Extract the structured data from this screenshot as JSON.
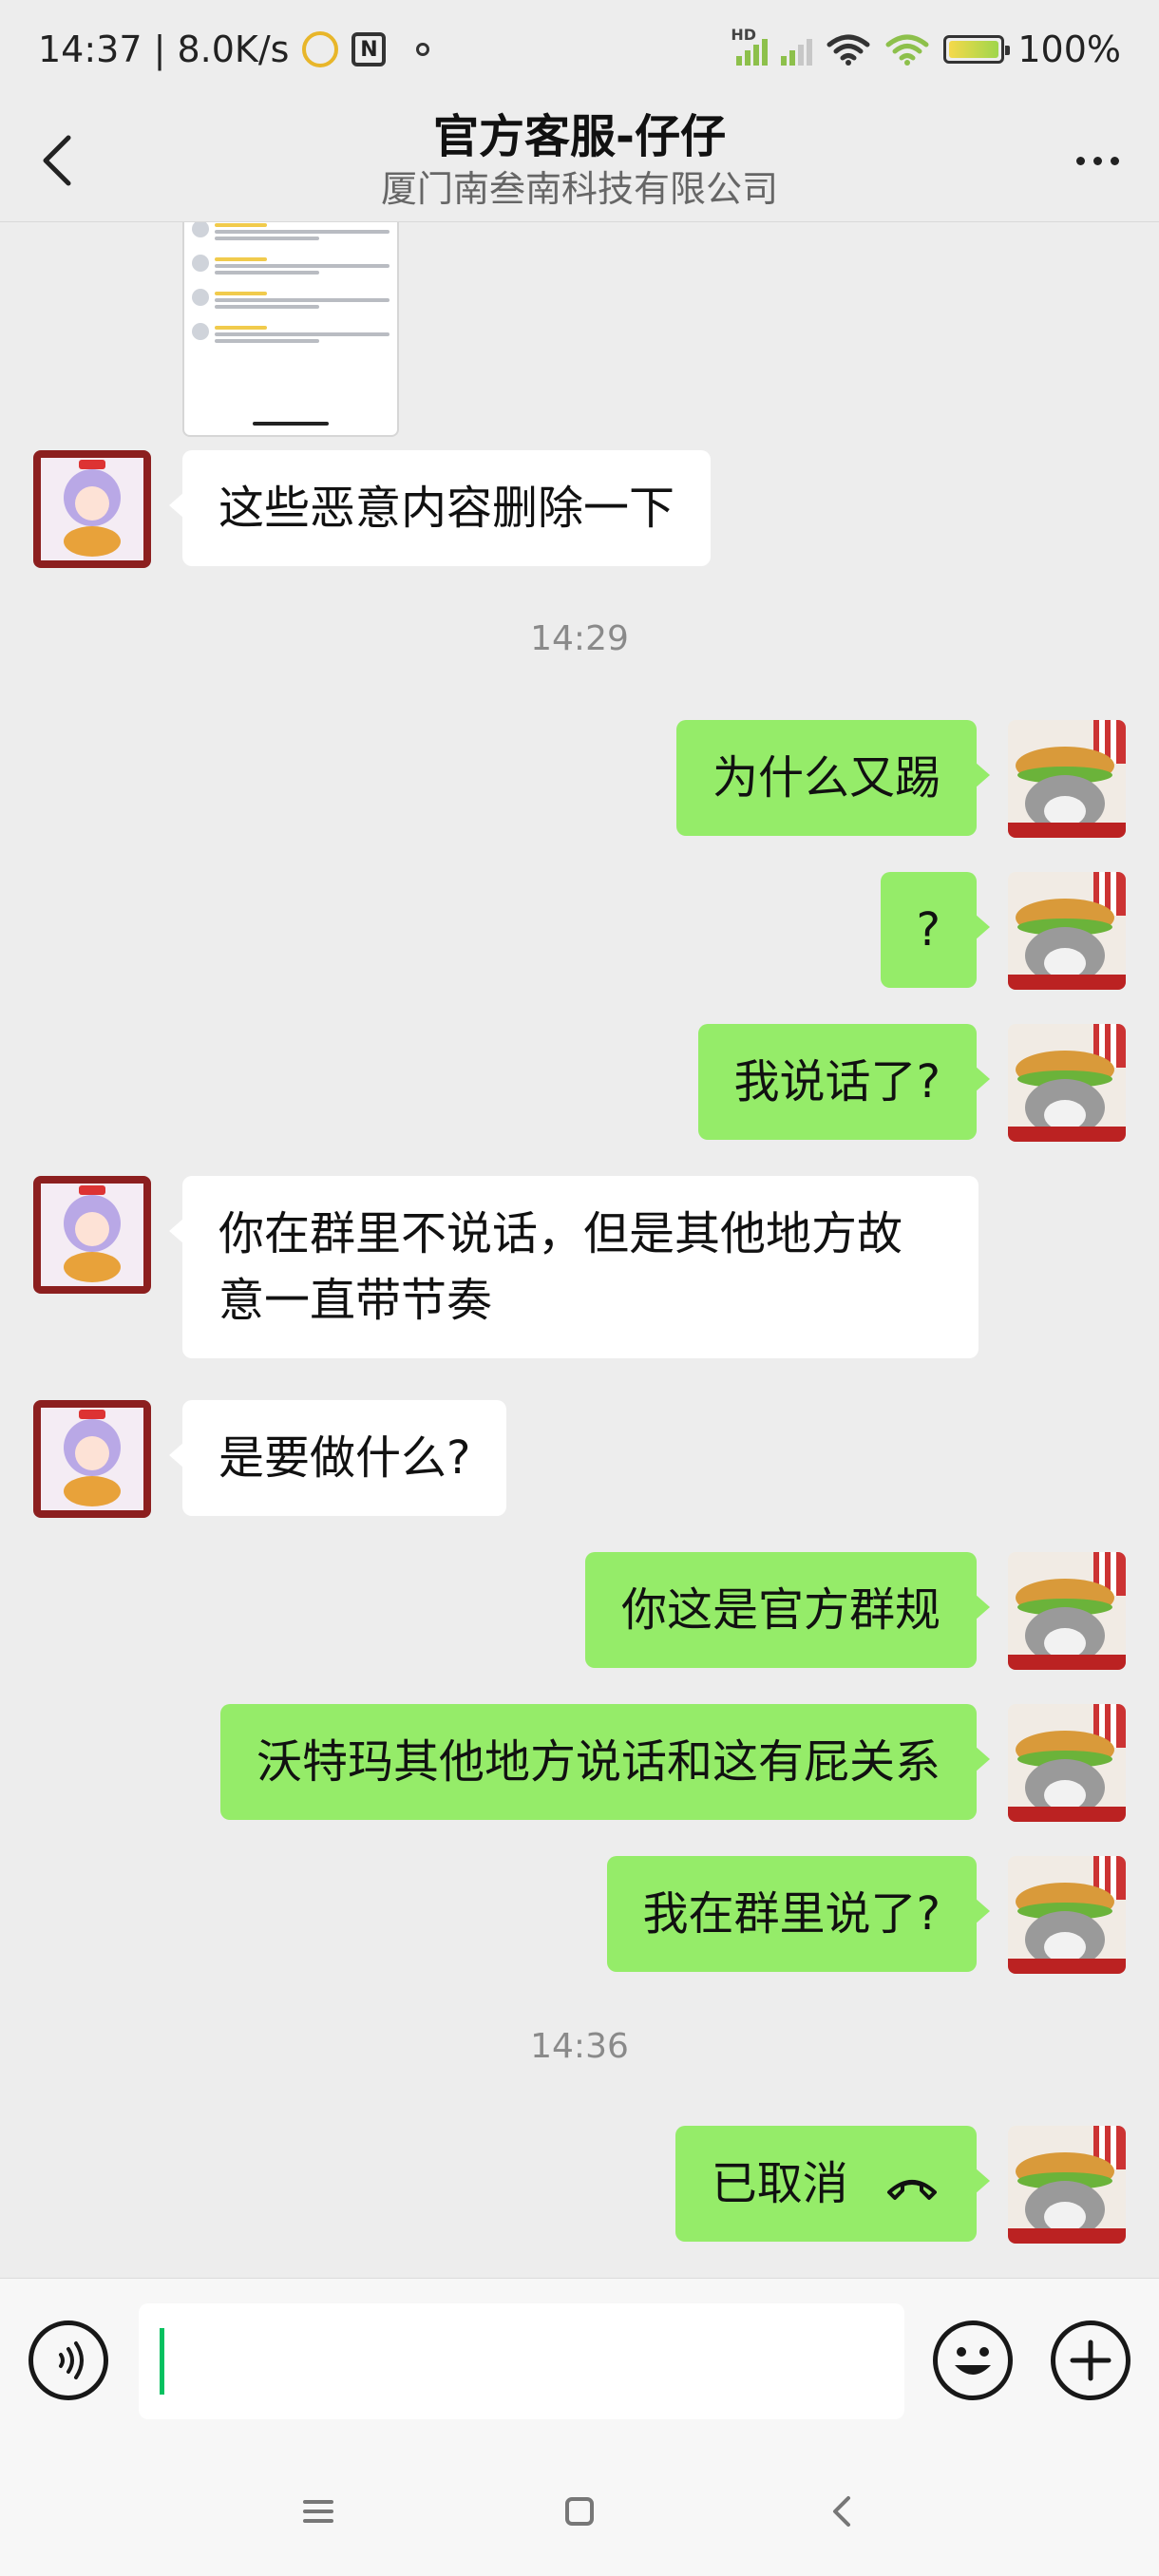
{
  "status_bar": {
    "time_speed": "14:37 | 8.0K/s",
    "hd_label": "HD",
    "battery_text": "100%",
    "battery_level": 1.0
  },
  "header": {
    "title": "官方客服-仔仔",
    "subtitle": "厦门南叁南科技有限公司",
    "back_icon": "chevron-left-icon",
    "more_icon": "more-dots-icon"
  },
  "messages": [
    {
      "side": "in",
      "kind": "image",
      "content": "screenshot-thumbnail"
    },
    {
      "side": "in",
      "kind": "text",
      "text": "这些恶意内容删除一下"
    },
    {
      "kind": "time",
      "text": "14:29"
    },
    {
      "side": "out",
      "kind": "text",
      "text": "为什么又踢"
    },
    {
      "side": "out",
      "kind": "text",
      "text": "?"
    },
    {
      "side": "out",
      "kind": "text",
      "text": "我说话了?"
    },
    {
      "side": "in",
      "kind": "text",
      "text": "你在群里不说话，但是其他地方故意一直带节奏"
    },
    {
      "side": "in",
      "kind": "text",
      "text": "是要做什么?"
    },
    {
      "side": "out",
      "kind": "text",
      "text": "你这是官方群规"
    },
    {
      "side": "out",
      "kind": "text",
      "text": "沃特玛其他地方说话和这有屁关系"
    },
    {
      "side": "out",
      "kind": "text",
      "text": "我在群里说了?"
    },
    {
      "kind": "time",
      "text": "14:36"
    },
    {
      "side": "out",
      "kind": "call",
      "text": "已取消",
      "icon": "phone-hangup-icon"
    }
  ],
  "input_bar": {
    "value": "",
    "voice_icon": "voice-icon",
    "emoji_icon": "emoji-icon",
    "plus_icon": "plus-icon"
  },
  "colors": {
    "background": "#ededed",
    "outgoing_bubble": "#95ec69",
    "incoming_bubble": "#ffffff",
    "caret": "#07c160"
  }
}
